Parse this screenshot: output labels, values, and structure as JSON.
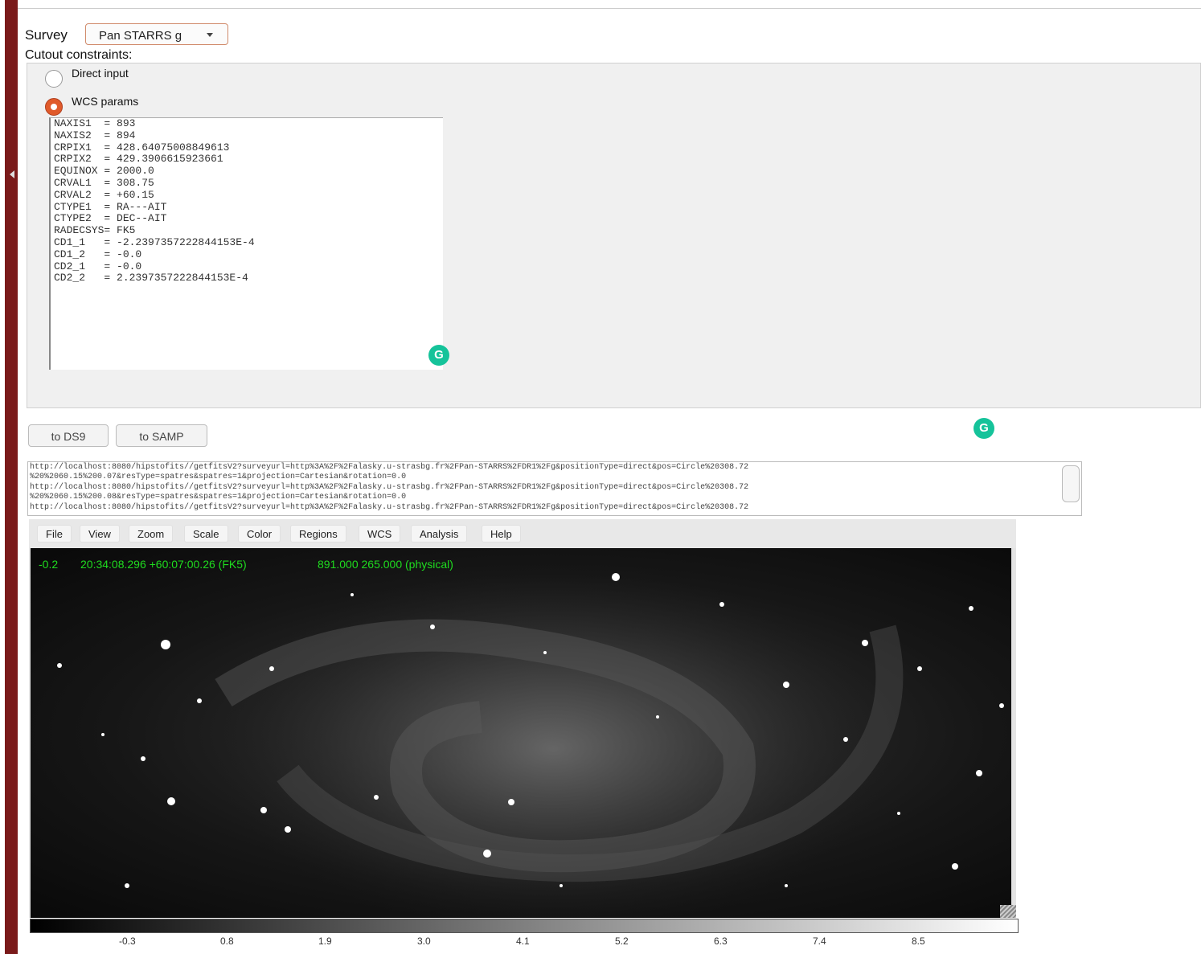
{
  "survey": {
    "label": "Survey",
    "selected": "Pan STARRS g"
  },
  "cutout": {
    "label": "Cutout constraints:",
    "options": [
      "Direct input",
      "WCS params"
    ],
    "selected_index": 1
  },
  "wcs_params": [
    "NAXIS1  = 893",
    "NAXIS2  = 894",
    "CRPIX1  = 428.64075008849613",
    "CRPIX2  = 429.3906615923661",
    "EQUINOX = 2000.0",
    "CRVAL1  = 308.75",
    "CRVAL2  = +60.15",
    "CTYPE1  = RA---AIT",
    "CTYPE2  = DEC--AIT",
    "RADECSYS= FK5",
    "CD1_1   = -2.2397357222844153E-4",
    "CD1_2   = -0.0",
    "CD2_1   = -0.0",
    "CD2_2   = 2.2397357222844153E-4"
  ],
  "grammarly_icon": "G",
  "buttons": {
    "ds9": "to DS9",
    "samp": "to SAMP"
  },
  "urls": [
    "http://localhost:8080/hipstofits//getfitsV2?surveyurl=http%3A%2F%2Falasky.u-strasbg.fr%2FPan-STARRS%2FDR1%2Fg&positionType=direct&pos=Circle%20308.72",
    "%20%2060.15%200.07&resType=spatres&spatres=1&projection=Cartesian&rotation=0.0",
    "http://localhost:8080/hipstofits//getfitsV2?surveyurl=http%3A%2F%2Falasky.u-strasbg.fr%2FPan-STARRS%2FDR1%2Fg&positionType=direct&pos=Circle%20308.72",
    "%20%2060.15%200.08&resType=spatres&spatres=1&projection=Cartesian&rotation=0.0",
    "http://localhost:8080/hipstofits//getfitsV2?surveyurl=http%3A%2F%2Falasky.u-strasbg.fr%2FPan-STARRS%2FDR1%2Fg&positionType=direct&pos=Circle%20308.72"
  ],
  "ds9": {
    "menu": [
      "File",
      "View",
      "Zoom",
      "Scale",
      "Color",
      "Regions",
      "WCS",
      "Analysis",
      "Help"
    ],
    "status": {
      "value": "-0.2",
      "coords": "20:34:08.296 +60:07:00.26 (FK5)",
      "physical": "891.000 265.000 (physical)"
    },
    "colorbar_ticks": [
      "-0.3",
      "0.8",
      "1.9",
      "3.0",
      "4.1",
      "5.2",
      "6.3",
      "7.4",
      "8.5"
    ]
  }
}
